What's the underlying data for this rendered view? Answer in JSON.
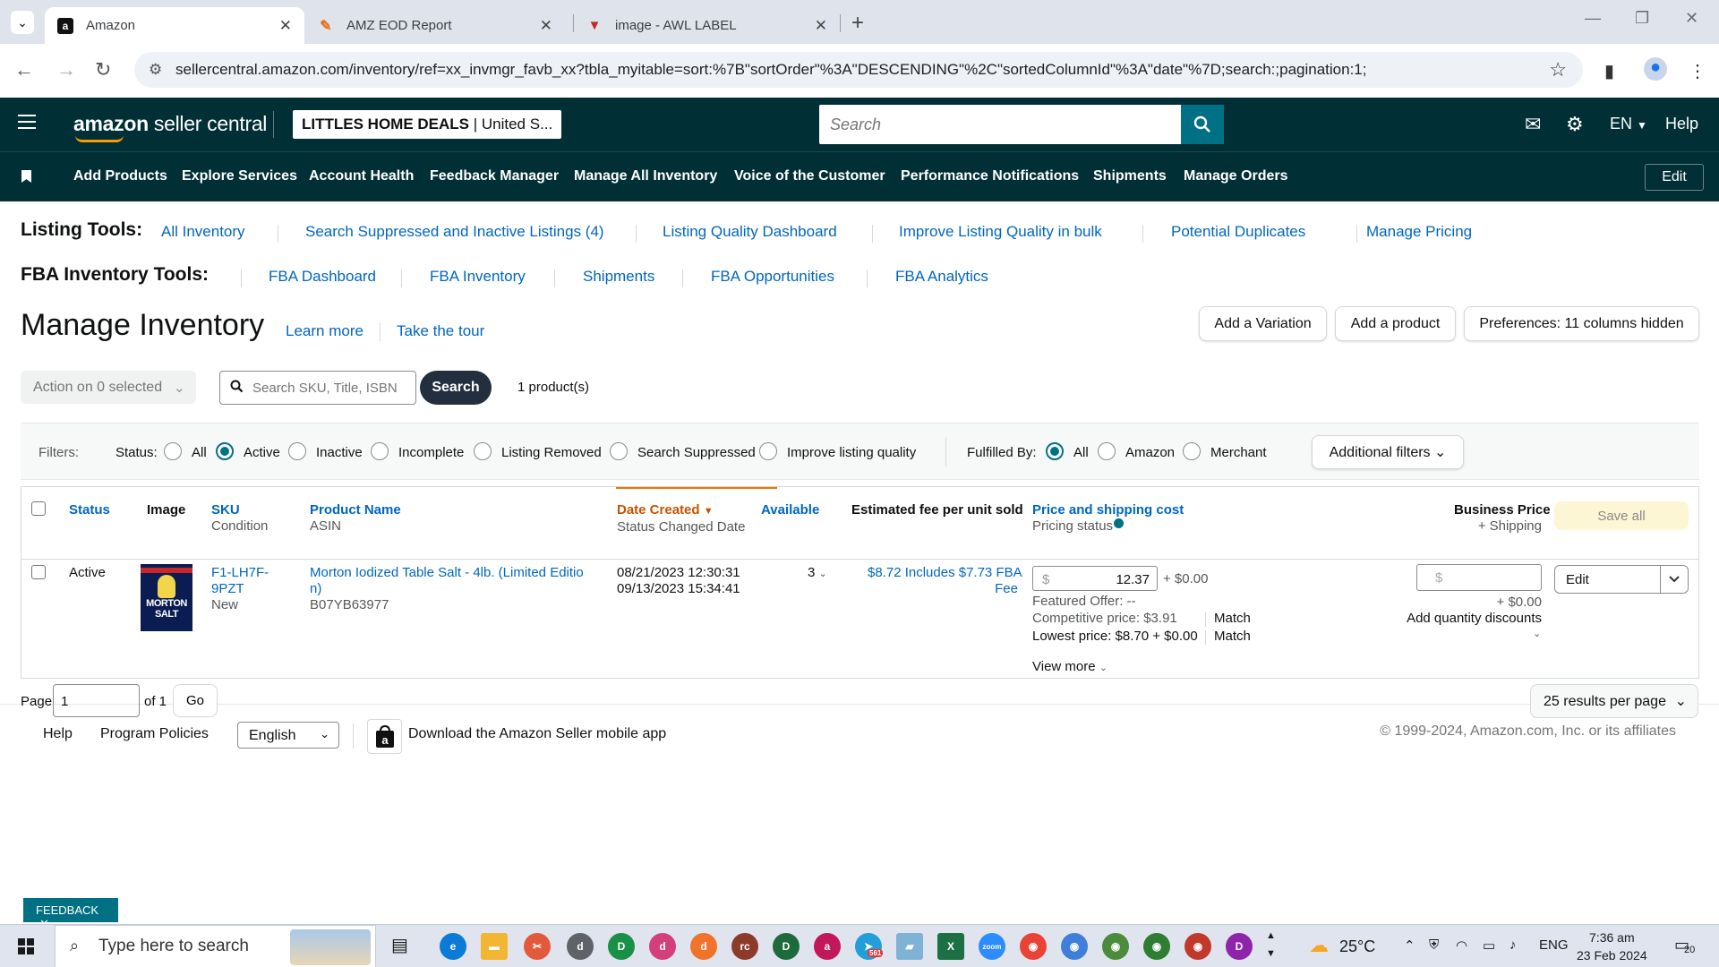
{
  "browser": {
    "tabs": [
      {
        "title": "Amazon",
        "favicon": "amazon-icon"
      },
      {
        "title": "AMZ EOD Report",
        "favicon": "pencil-icon"
      },
      {
        "title": "image - AWL LABEL",
        "favicon": "awl-icon"
      }
    ],
    "url": "sellercentral.amazon.com/inventory/ref=xx_invmgr_favb_xx?tbla_myitable=sort:%7B\"sortOrder\"%3A\"DESCENDING\"%2C\"sortedColumnId\"%3A\"date\"%7D;search:;pagination:1;"
  },
  "header": {
    "logo_bold": "amazon",
    "logo_rest": " seller central",
    "store_bold": "LITTLES HOME DEALS",
    "store_rest": " | United S...",
    "search_placeholder": "Search",
    "lang": "EN",
    "help": "Help"
  },
  "nav": {
    "items": [
      "Add Products",
      "Explore Services",
      "Account Health",
      "Feedback Manager",
      "Manage All Inventory",
      "Voice of the Customer",
      "Performance Notifications",
      "Shipments",
      "Manage Orders"
    ],
    "edit": "Edit"
  },
  "listing_tools": {
    "label": "Listing Tools:",
    "links": [
      "All Inventory",
      "Search Suppressed and Inactive Listings (4)",
      "Listing Quality Dashboard",
      "Improve Listing Quality in bulk",
      "Potential Duplicates",
      "Manage Pricing"
    ]
  },
  "fba_tools": {
    "label": "FBA Inventory Tools:",
    "links": [
      "FBA Dashboard",
      "FBA Inventory",
      "Shipments",
      "FBA Opportunities",
      "FBA Analytics"
    ]
  },
  "page": {
    "title": "Manage Inventory",
    "learn_more": "Learn more",
    "take_tour": "Take the tour",
    "add_variation": "Add a Variation",
    "add_product": "Add a product",
    "preferences": "Preferences: 11 columns hidden"
  },
  "search_row": {
    "action": "Action on 0 selected",
    "placeholder": "Search SKU, Title, ISBN",
    "search_btn": "Search",
    "count": "1 product(s)"
  },
  "filters": {
    "label": "Filters:",
    "status_label": "Status:",
    "status_options": [
      "All",
      "Active",
      "Inactive",
      "Incomplete",
      "Listing Removed",
      "Search Suppressed",
      "Improve listing quality"
    ],
    "status_selected": "Active",
    "fulfilled_label": "Fulfilled By:",
    "fulfilled_options": [
      "All",
      "Amazon",
      "Merchant"
    ],
    "fulfilled_selected": "All",
    "additional": "Additional filters"
  },
  "table": {
    "headers": {
      "status": "Status",
      "image": "Image",
      "sku": "SKU",
      "sku_sub": "Condition",
      "product": "Product Name",
      "product_sub": "ASIN",
      "date": "Date Created",
      "date_sub": "Status Changed Date",
      "available": "Available",
      "fee": "Estimated fee per unit sold",
      "price": "Price and shipping cost",
      "price_sub": "Pricing status",
      "business": "Business Price",
      "business_sub": "+ Shipping",
      "save_all": "Save all"
    },
    "row": {
      "status": "Active",
      "image_text": "MORTON SALT",
      "sku_line1": "F1-LH7F-",
      "sku_line2": "9PZT",
      "condition": "New",
      "product_line1": "Morton Iodized Table Salt - 4lb. (Limited Editio",
      "product_line2": "n)",
      "asin": "B07YB63977",
      "date_created": "08/21/2023 12:30:31",
      "status_changed": "09/13/2023 15:34:41",
      "available": "3",
      "fee_line1": "$8.72 Includes $7.73 FBA",
      "fee_line2": "Fee",
      "currency": "$",
      "price": "12.37",
      "shipping": "+ $0.00",
      "featured_offer": "Featured Offer: --",
      "competitive": "Competitive price: $3.91",
      "lowest": "Lowest price: $8.70 + $0.00",
      "match": "Match",
      "view_more": "View more",
      "bp_currency": "$",
      "bp_shipping": "+ $0.00",
      "quantity_discounts": "Add quantity discounts",
      "edit": "Edit"
    }
  },
  "pagination": {
    "page_label": "Page",
    "page_value": "1",
    "of": "of 1",
    "go": "Go",
    "per_page": "25 results per page"
  },
  "footer": {
    "help": "Help",
    "policies": "Program Policies",
    "language": "English",
    "download": "Download the Amazon Seller mobile app",
    "copyright": "© 1999-2024, Amazon.com, Inc. or its affiliates"
  },
  "feedback": "FEEDBACK",
  "taskbar": {
    "search": "Type here to search",
    "weather": "25°C",
    "lang": "ENG",
    "time": "7:36 am",
    "date": "23 Feb 2024",
    "notifications": "20",
    "badge": "561"
  },
  "colors": {
    "header_bg": "#002f36",
    "link": "#0066c0",
    "accent_teal": "#007185",
    "sort_orange": "#e77600"
  }
}
